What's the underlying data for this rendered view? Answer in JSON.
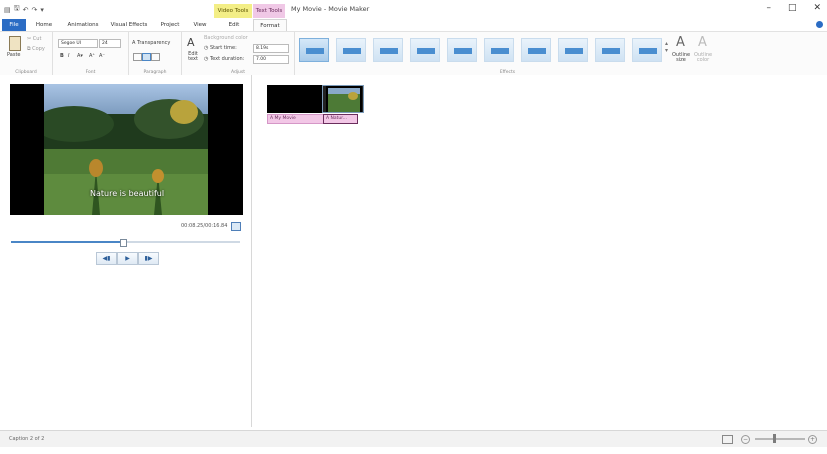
{
  "titlebar": {
    "title": "My Movie - Movie Maker",
    "context_video": "Video Tools",
    "context_text": "Text Tools",
    "min": "–",
    "max": "□",
    "close": "✕"
  },
  "tabs": [
    "File",
    "Home",
    "Animations",
    "Visual Effects",
    "Project",
    "View",
    "Edit",
    "Format"
  ],
  "ribbon": {
    "clipboard": {
      "paste": "Paste",
      "cut": "Cut",
      "copy": "Copy",
      "label": "Clipboard"
    },
    "font": {
      "family": "Segoe UI",
      "size": "24",
      "label": "Font",
      "transparency": "Transparency"
    },
    "paragraph": {
      "label": "Paragraph"
    },
    "adjust": {
      "edit_text": "Edit text",
      "background": "Background color",
      "start_time": "Start time:",
      "start_value": "8.19s",
      "duration": "Text duration:",
      "duration_value": "7.00",
      "label": "Adjust"
    },
    "effects": {
      "label": "Effects",
      "outline_size": "Outline size",
      "outline_color": "Outline color"
    }
  },
  "preview": {
    "caption": "Nature is beautiful",
    "time": "00:08.25/00:16.84",
    "progress": 0.49,
    "prev": "◀▮",
    "play": "▶",
    "next": "▮▶"
  },
  "storyboard": {
    "clip1_label": "A My Movie",
    "clip2_label": "A Natur..."
  },
  "status": {
    "text": "Caption 2 of 2"
  },
  "colors": {
    "accent": "#2b6cc4",
    "video_tools": "#f3ee86",
    "text_tools": "#f0c8e6"
  }
}
